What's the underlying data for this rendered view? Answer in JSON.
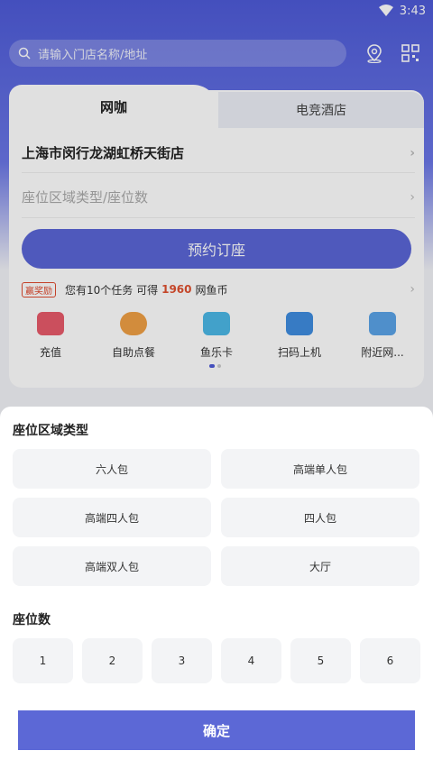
{
  "status_bar": {
    "time": "3:43"
  },
  "search": {
    "placeholder": "请输入门店名称/地址"
  },
  "tabs": [
    {
      "label": "网咖"
    },
    {
      "label": "电竞酒店"
    }
  ],
  "store": {
    "name": "上海市闵行龙湖虹桥天街店"
  },
  "seat_selector": {
    "placeholder": "座位区域类型/座位数"
  },
  "book_button": {
    "label": "预约订座"
  },
  "reward": {
    "badge": "赢奖励",
    "prefix": "您有10个任务 可得",
    "amount": "1960",
    "suffix": "网鱼币"
  },
  "quick_actions": [
    {
      "label": "充值"
    },
    {
      "label": "自助点餐"
    },
    {
      "label": "鱼乐卡"
    },
    {
      "label": "扫码上机"
    },
    {
      "label": "附近网..."
    }
  ],
  "sheet": {
    "area_title": "座位区域类型",
    "areas": [
      "六人包",
      "高端单人包",
      "高端四人包",
      "四人包",
      "高端双人包",
      "大厅"
    ],
    "count_title": "座位数",
    "counts": [
      "1",
      "2",
      "3",
      "4",
      "5",
      "6"
    ],
    "confirm": "确定"
  },
  "colors": {
    "primary": "#5c68d6",
    "accent": "#e0502f"
  }
}
